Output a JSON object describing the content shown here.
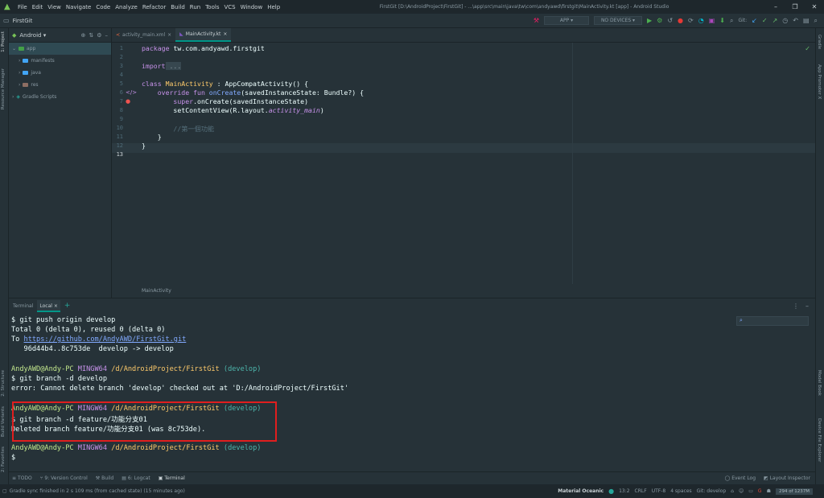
{
  "title_bar": {
    "menu": [
      "File",
      "Edit",
      "View",
      "Navigate",
      "Code",
      "Analyze",
      "Refactor",
      "Build",
      "Run",
      "Tools",
      "VCS",
      "Window",
      "Help"
    ],
    "title": "FirstGit [D:\\AndroidProject\\FirstGit] - ...\\app\\src\\main\\java\\tw\\com\\andyawd\\firstgit\\MainActivity.kt [app] - Android Studio"
  },
  "nav_bar": {
    "breadcrumb": "FirstGit",
    "run_config": "APP",
    "device": "NO DEVICES",
    "git_label": "Git:"
  },
  "left_strip": {
    "tabs": [
      "1: Project",
      "Resource Manager",
      "2: Structure",
      "Build Variants",
      "2: Favorites"
    ]
  },
  "right_strip": {
    "tabs": [
      "Gradle",
      "App Promoter X",
      "Model Book",
      "Device File Explorer"
    ]
  },
  "project_panel": {
    "view_mode": "Android",
    "items": [
      {
        "label": "app",
        "level": 0,
        "selected": true
      },
      {
        "label": "manifests",
        "level": 1
      },
      {
        "label": "java",
        "level": 1
      },
      {
        "label": "res",
        "level": 1
      },
      {
        "label": "Gradle Scripts",
        "level": 0
      }
    ]
  },
  "editor": {
    "tabs": [
      {
        "label": "activity_main.xml",
        "active": false
      },
      {
        "label": "MainActivity.kt",
        "active": true
      }
    ],
    "line_numbers": [
      "1",
      "2",
      "3",
      "4",
      "5",
      "6",
      "7",
      "8",
      "9",
      "10",
      "11",
      "12",
      "13"
    ],
    "code": {
      "l1_kw": "package",
      "l1_rest": " tw.com.andyawd.firstgit",
      "l3_kw": "import",
      "l3_fold": " ...",
      "l6_kw": "class",
      "l6_name": " MainActivity",
      "l6_rest": " : AppCompatActivity() {",
      "l7_kw": "    override fun",
      "l7_fn": " onCreate",
      "l7_rest": "(savedInstanceState: Bundle?) {",
      "l8_kw": "        super",
      "l8_rest": ".onCreate(savedInstanceState)",
      "l9_a": "        setContentView(R.layout.",
      "l9_b": "activity_main",
      "l9_c": ")",
      "l11_cm": "        //第一個功能",
      "l12": "    }",
      "l13": "}"
    },
    "footer_breadcrumb": "MainActivity"
  },
  "terminal": {
    "tabs": [
      "Terminal",
      "Local"
    ],
    "lines": {
      "t1": "$ git push origin develop",
      "t2": "Total 0 (delta 0), reused 0 (delta 0)",
      "t3a": "To ",
      "t3b": "https://github.com/AndyAWD/FirstGit.git",
      "t4": "   96d44b4..8c753de  develop -> develop",
      "p1_user": "AndyAWD@Andy-PC",
      "p1_sys": " MINGW64",
      "p1_path": " /d/AndroidProject/FirstGit",
      "p1_br": " (develop)",
      "t6": "$ git branch -d develop",
      "t7": "error: Cannot delete branch 'develop' checked out at 'D:/AndroidProject/FirstGit'",
      "t9": "$ git branch -d feature/功能分支01",
      "t10": "Deleted branch feature/功能分支01 (was 8c753de).",
      "t12": "$"
    }
  },
  "tool_strip": {
    "items": [
      "TODO",
      "9: Version Control",
      "Build",
      "6: Logcat",
      "Terminal"
    ],
    "right_items": [
      "Event Log",
      "Layout Inspector"
    ]
  },
  "status_bar": {
    "message": "Gradle sync finished in 2 s 109 ms (from cached state) (15 minutes ago)",
    "theme": "Material Oceanic",
    "position": "13:2",
    "line_sep": "CRLF",
    "encoding": "UTF-8",
    "indent": "4 spaces",
    "git": "Git: develop",
    "memory": "294 of 1237M"
  },
  "colors": {
    "accent": "#009688",
    "highlight_box": "#e01e1e",
    "background": "#263238"
  }
}
